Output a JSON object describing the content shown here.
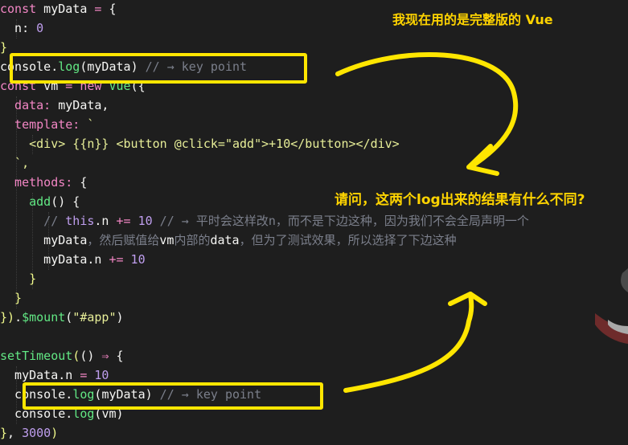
{
  "colors": {
    "bg": "#1e1e1e",
    "annotation": "#ffe600",
    "guide": "#3c3c3c"
  },
  "annotations": {
    "title": "我现在用的是完整版的 Vue",
    "question": "请问，这两个log出来的结果有什么不同?"
  },
  "icons": {
    "arrow_top": "curved-arrow-icon",
    "arrow_bottom": "curved-arrow-icon"
  },
  "code_lines": [
    {
      "name": "code-line-1",
      "tokens": [
        {
          "t": "const",
          "c": "#f286c4"
        },
        {
          "t": " myData ",
          "c": "#f6f6f4"
        },
        {
          "t": "=",
          "c": "#f286c4"
        },
        {
          "t": " {",
          "c": "#f6f6f4"
        }
      ]
    },
    {
      "name": "code-line-2",
      "tokens": [
        {
          "t": "  n:",
          "c": "#f6f6f4"
        },
        {
          "t": " 0",
          "c": "#bf9eee"
        }
      ]
    },
    {
      "name": "code-line-3",
      "tokens": [
        {
          "t": "}",
          "c": "#f1fa8c"
        }
      ]
    },
    {
      "name": "code-line-4",
      "tokens": [
        {
          "t": "console",
          "c": "#f6f6f4"
        },
        {
          "t": ".",
          "c": "#f6f6f4"
        },
        {
          "t": "log",
          "c": "#62e884"
        },
        {
          "t": "(",
          "c": "#f6f6f4"
        },
        {
          "t": "myData",
          "c": "#f6f6f4"
        },
        {
          "t": ")",
          "c": "#f6f6f4"
        },
        {
          "t": " // ",
          "c": "#7b7f8b"
        },
        {
          "t": "→",
          "c": "#7b7f8b"
        },
        {
          "t": " key point",
          "c": "#7b7f8b"
        }
      ]
    },
    {
      "name": "code-line-5",
      "tokens": [
        {
          "t": "const",
          "c": "#f286c4"
        },
        {
          "t": " vm ",
          "c": "#f6f6f4"
        },
        {
          "t": "=",
          "c": "#f286c4"
        },
        {
          "t": " new",
          "c": "#f286c4"
        },
        {
          "t": " Vue",
          "c": "#62e884"
        },
        {
          "t": "({",
          "c": "#f6f6f4"
        }
      ]
    },
    {
      "name": "code-line-6",
      "tokens": [
        {
          "t": "  data:",
          "c": "#f286c4"
        },
        {
          "t": " myData,",
          "c": "#f6f6f4"
        }
      ]
    },
    {
      "name": "code-line-7",
      "tokens": [
        {
          "t": "  template:",
          "c": "#f286c4"
        },
        {
          "t": " `",
          "c": "#e7ee98"
        }
      ]
    },
    {
      "name": "code-line-8",
      "tokens": [
        {
          "t": "    <div>",
          "c": "#e7ee98"
        },
        {
          "t": " {{n}}",
          "c": "#e7ee98"
        },
        {
          "t": " <button @click=\"add\">+10</button></div>",
          "c": "#e7ee98"
        }
      ]
    },
    {
      "name": "code-line-9",
      "tokens": [
        {
          "t": "  `,",
          "c": "#e7ee98"
        }
      ]
    },
    {
      "name": "code-line-10",
      "tokens": [
        {
          "t": "  methods:",
          "c": "#f286c4"
        },
        {
          "t": " {",
          "c": "#f6f6f4"
        }
      ]
    },
    {
      "name": "code-line-11",
      "tokens": [
        {
          "t": "    add",
          "c": "#62e884"
        },
        {
          "t": "()",
          "c": "#f6f6f4"
        },
        {
          "t": " {",
          "c": "#f6f6f4"
        }
      ]
    },
    {
      "name": "code-line-12",
      "tokens": [
        {
          "t": "      // ",
          "c": "#7b7f8b"
        },
        {
          "t": "this",
          "c": "#bf9eee"
        },
        {
          "t": ".n ",
          "c": "#f6f6f4"
        },
        {
          "t": "+=",
          "c": "#f286c4"
        },
        {
          "t": " 10",
          "c": "#bf9eee"
        },
        {
          "t": " // → 平时会这样改n，而不是下边这种，因为我们不会全局声明一个",
          "c": "#7b7f8b"
        }
      ]
    },
    {
      "name": "code-line-13",
      "tokens": [
        {
          "t": "      myData",
          "c": "#f6f6f4"
        },
        {
          "t": "，然后赋值给",
          "c": "#7b7f8b"
        },
        {
          "t": "vm",
          "c": "#f6f6f4"
        },
        {
          "t": "内部的",
          "c": "#7b7f8b"
        },
        {
          "t": "data",
          "c": "#f6f6f4"
        },
        {
          "t": "，但为了测试效果，所以选择了下边这种",
          "c": "#7b7f8b"
        }
      ]
    },
    {
      "name": "code-line-14",
      "tokens": [
        {
          "t": "      myData",
          "c": "#f6f6f4"
        },
        {
          "t": ".n ",
          "c": "#f6f6f4"
        },
        {
          "t": "+=",
          "c": "#f286c4"
        },
        {
          "t": " 10",
          "c": "#bf9eee"
        }
      ]
    },
    {
      "name": "code-line-15",
      "tokens": [
        {
          "t": "    }",
          "c": "#f1fa8c"
        }
      ]
    },
    {
      "name": "code-line-16",
      "tokens": [
        {
          "t": "  }",
          "c": "#f1fa8c"
        }
      ]
    },
    {
      "name": "code-line-17",
      "tokens": [
        {
          "t": "})",
          "c": "#f1fa8c"
        },
        {
          "t": ".",
          "c": "#f6f6f4"
        },
        {
          "t": "$mount",
          "c": "#62e884"
        },
        {
          "t": "(",
          "c": "#f6f6f4"
        },
        {
          "t": "\"#app\"",
          "c": "#e7ee98"
        },
        {
          "t": ")",
          "c": "#f6f6f4"
        }
      ]
    },
    {
      "name": "code-line-18",
      "tokens": []
    },
    {
      "name": "code-line-19",
      "tokens": [
        {
          "t": "setTimeout",
          "c": "#62e884"
        },
        {
          "t": "(",
          "c": "#f1fa8c"
        },
        {
          "t": "()",
          "c": "#f6f6f4"
        },
        {
          "t": " ⇒ ",
          "c": "#f286c4"
        },
        {
          "t": "{",
          "c": "#f6f6f4"
        }
      ]
    },
    {
      "name": "code-line-20",
      "tokens": [
        {
          "t": "  myData.n ",
          "c": "#f6f6f4"
        },
        {
          "t": "=",
          "c": "#f286c4"
        },
        {
          "t": " 10",
          "c": "#bf9eee"
        }
      ]
    },
    {
      "name": "code-line-21",
      "tokens": [
        {
          "t": "  console",
          "c": "#f6f6f4"
        },
        {
          "t": ".",
          "c": "#f6f6f4"
        },
        {
          "t": "log",
          "c": "#62e884"
        },
        {
          "t": "(",
          "c": "#f6f6f4"
        },
        {
          "t": "myData",
          "c": "#f6f6f4"
        },
        {
          "t": ")",
          "c": "#f6f6f4"
        },
        {
          "t": " // ",
          "c": "#7b7f8b"
        },
        {
          "t": "→",
          "c": "#7b7f8b"
        },
        {
          "t": " key point",
          "c": "#7b7f8b"
        }
      ]
    },
    {
      "name": "code-line-22",
      "tokens": [
        {
          "t": "  console",
          "c": "#f6f6f4"
        },
        {
          "t": ".",
          "c": "#f6f6f4"
        },
        {
          "t": "log",
          "c": "#62e884"
        },
        {
          "t": "(",
          "c": "#f6f6f4"
        },
        {
          "t": "vm",
          "c": "#f6f6f4"
        },
        {
          "t": ")",
          "c": "#f6f6f4"
        }
      ]
    },
    {
      "name": "code-line-23",
      "tokens": [
        {
          "t": "}",
          "c": "#f1fa8c"
        },
        {
          "t": ", ",
          "c": "#f6f6f4"
        },
        {
          "t": "3000",
          "c": "#bf9eee"
        },
        {
          "t": ")",
          "c": "#f1fa8c"
        }
      ]
    }
  ]
}
